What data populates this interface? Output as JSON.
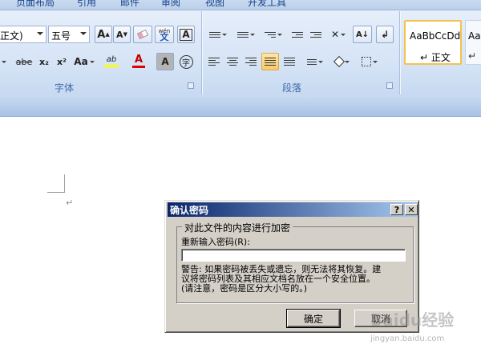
{
  "ribbon": {
    "tabs": [
      "页面布局",
      "引用",
      "邮件",
      "审阅",
      "视图",
      "开发工具"
    ],
    "font_name": "正文)",
    "font_size": "五号",
    "group_font_label": "字体",
    "group_paragraph_label": "段落",
    "styles": [
      {
        "sample": "AaBbCcDd",
        "name": "↵ 正文"
      },
      {
        "sample": "AaB",
        "name": "↵"
      }
    ],
    "glyphs": {
      "grow": "A",
      "shrink": "A",
      "phonetic": "wén",
      "phonetic_char": "文",
      "border_char": "A",
      "strike": "abe",
      "sub": "x₂",
      "sup": "x²",
      "case": "Aa",
      "highlight": "ab",
      "font_color": "A",
      "shading": "A",
      "enclose": "字"
    }
  },
  "document": {
    "para_mark": "↵"
  },
  "dialog": {
    "title": "确认密码",
    "help_button": "?",
    "close_button": "✕",
    "group_title": "对此文件的内容进行加密",
    "field_label": "重新输入密码(R):",
    "password_value": "",
    "warning_lines": [
      "警告: 如果密码被丢失或遗忘，则无法将其恢复。建",
      "议将密码列表及其相应文档名放在一个安全位置。",
      "(请注意，密码是区分大小写的。)"
    ],
    "ok_label": "确定",
    "cancel_label": "取消"
  },
  "watermark": {
    "text": "Baidu经验",
    "sub": "jingyan.baidu.com"
  },
  "colors": {
    "dialog_bg": "#d4d0c8",
    "title_start": "#0a246a",
    "title_end": "#a6caf0",
    "ribbon": "#d6e4f6",
    "style_border": "#f3c24a"
  }
}
